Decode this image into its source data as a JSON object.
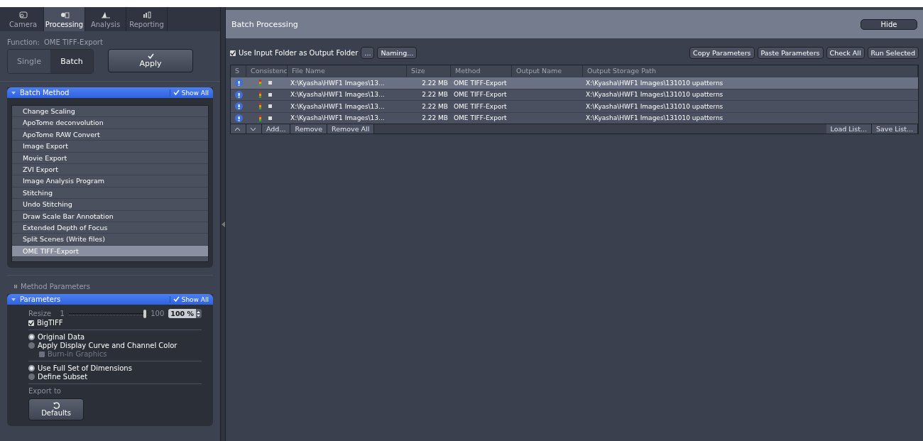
{
  "tabs": [
    {
      "label": "Camera",
      "selected": false
    },
    {
      "label": "Processing",
      "selected": true
    },
    {
      "label": "Analysis",
      "selected": false
    },
    {
      "label": "Reporting",
      "selected": false
    }
  ],
  "function_label": "Function:",
  "function_value": "OME TIFF-Export",
  "modes": [
    {
      "label": "Single",
      "selected": false
    },
    {
      "label": "Batch",
      "selected": true
    }
  ],
  "apply_button": "Apply",
  "batch_method": {
    "title": "Batch Method",
    "show_all": "Show All",
    "items": [
      {
        "label": "Change Scaling",
        "selected": false
      },
      {
        "label": "ApoTome deconvolution",
        "selected": false
      },
      {
        "label": "ApoTome RAW Convert",
        "selected": false
      },
      {
        "label": "Image Export",
        "selected": false
      },
      {
        "label": "Movie Export",
        "selected": false
      },
      {
        "label": "ZVI Export",
        "selected": false
      },
      {
        "label": "Image Analysis Program",
        "selected": false
      },
      {
        "label": "Stitching",
        "selected": false
      },
      {
        "label": "Undo Stitching",
        "selected": false
      },
      {
        "label": "Draw Scale Bar Annotation",
        "selected": false
      },
      {
        "label": "Extended Depth of Focus",
        "selected": false
      },
      {
        "label": "Split Scenes (Write files)",
        "selected": false
      },
      {
        "label": "OME TIFF-Export",
        "selected": true
      }
    ]
  },
  "method_parameters_label": "Method Parameters",
  "parameters": {
    "title": "Parameters",
    "show_all": "Show All",
    "resize": {
      "label": "Resize",
      "min": "1",
      "max": "100",
      "level": 1.0,
      "value": "100 %"
    },
    "options": [
      {
        "kind": "checkbox",
        "label": "BigTIFF",
        "checked": true,
        "disabled": false
      },
      {
        "kind": "divider"
      },
      {
        "kind": "radio",
        "label": "Original Data",
        "selected": true
      },
      {
        "kind": "radio",
        "label": "Apply Display Curve and Channel Color",
        "selected": false
      },
      {
        "kind": "subcheckbox",
        "label": "Burn-in Graphics",
        "checked": false,
        "disabled": true
      },
      {
        "kind": "divider"
      },
      {
        "kind": "radio",
        "label": "Use Full Set of Dimensions",
        "selected": true
      },
      {
        "kind": "radio",
        "label": "Define Subset",
        "selected": false
      },
      {
        "kind": "divider"
      }
    ],
    "export_to": "Export to",
    "defaults_button": "Defaults"
  },
  "batch": {
    "title": "Batch Processing",
    "hide_button": "Hide",
    "use_input_folder": {
      "label": "Use Input Folder as Output Folder",
      "checked": true
    },
    "browse_button": "...",
    "naming_button": "Naming...",
    "actions": [
      "Copy Parameters",
      "Paste Parameters",
      "Check All",
      "Run Selected"
    ],
    "columns": [
      "S",
      "Consistenc",
      "File Name",
      "Size",
      "Method",
      "Output Name",
      "Output Storage Path"
    ],
    "rows": [
      {
        "selected": true,
        "file": "X:\\Kyasha\\HWF1 Images\\13...",
        "size": "2.22 MB",
        "method": "OME TIFF-Export",
        "path": "X:\\Kyasha\\HWF1 Images\\131010 upatterns"
      },
      {
        "selected": false,
        "file": "X:\\Kyasha\\HWF1 Images\\13...",
        "size": "2.22 MB",
        "method": "OME TIFF-Export",
        "path": "X:\\Kyasha\\HWF1 Images\\131010 upatterns"
      },
      {
        "selected": false,
        "file": "X:\\Kyasha\\HWF1 Images\\13...",
        "size": "2.22 MB",
        "method": "OME TIFF-Export",
        "path": "X:\\Kyasha\\HWF1 Images\\131010 upatterns"
      },
      {
        "selected": false,
        "file": "X:\\Kyasha\\HWF1 Images\\13...",
        "size": "2.22 MB",
        "method": "OME TIFF-Export",
        "path": "X:\\Kyasha\\HWF1 Images\\131010 upatterns"
      }
    ],
    "footer_left": [
      "Add...",
      "Remove",
      "Remove All"
    ],
    "footer_right": [
      "Load List...",
      "Save List..."
    ]
  }
}
